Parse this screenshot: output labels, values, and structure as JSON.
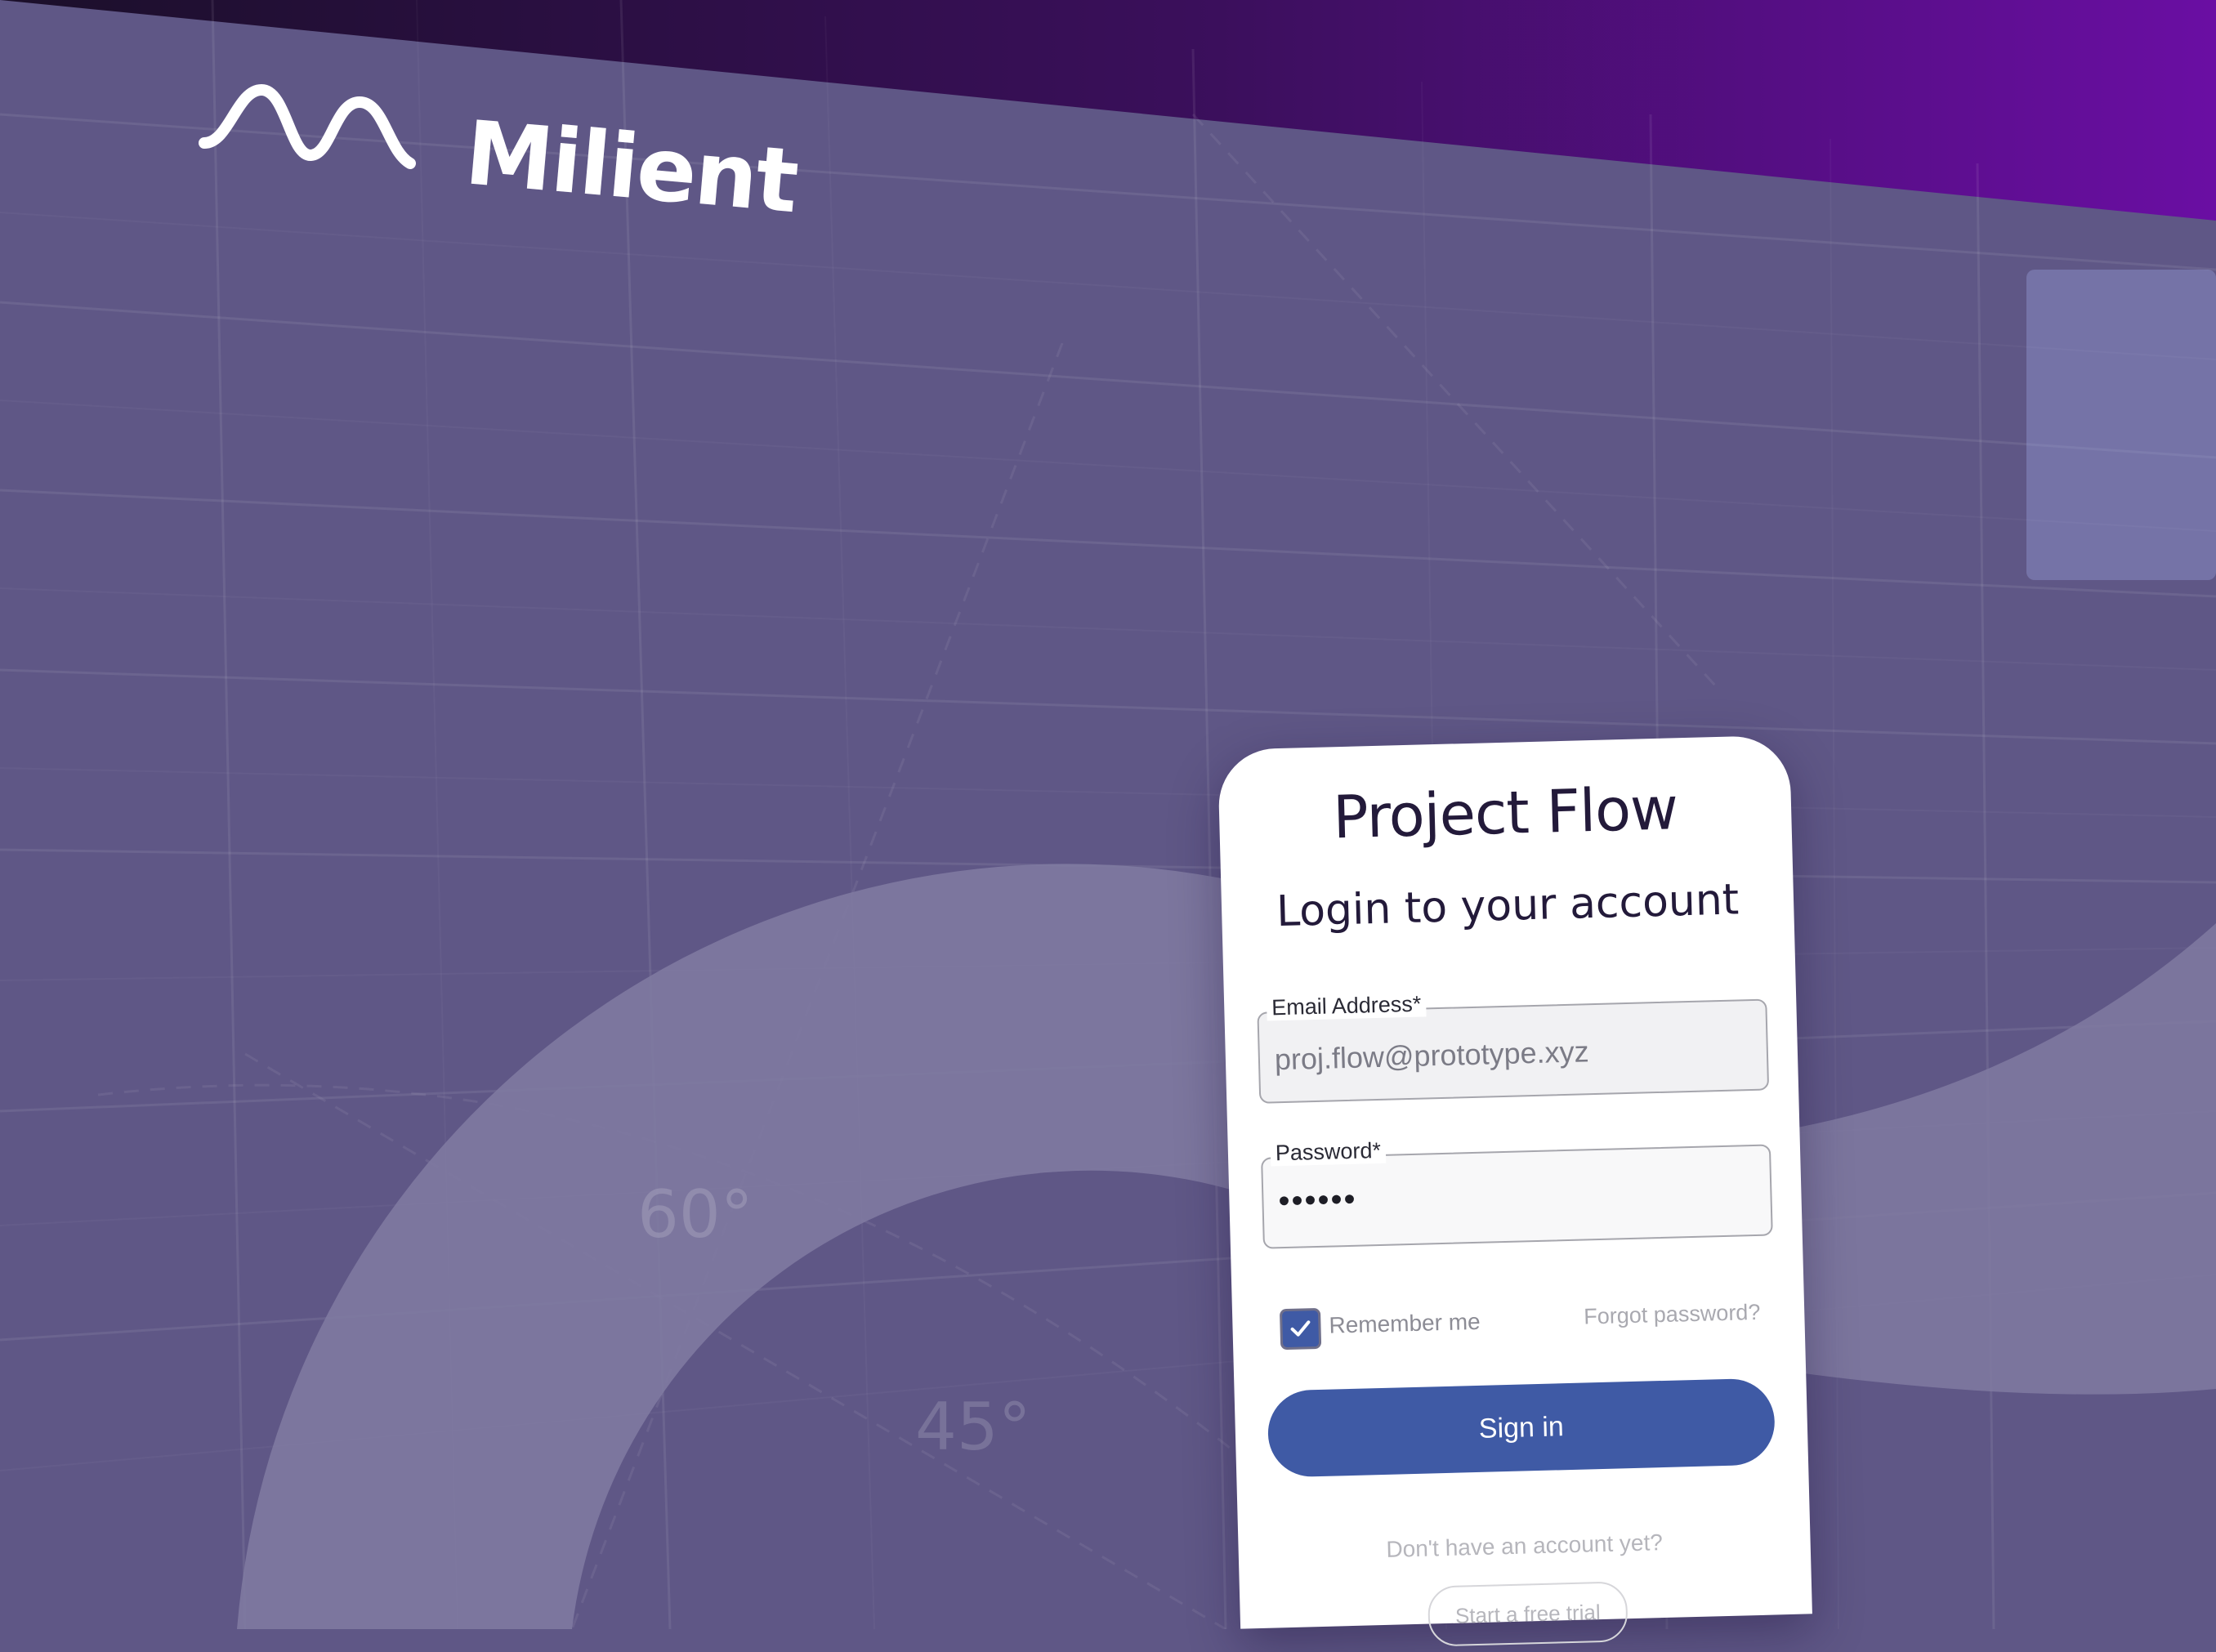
{
  "brand": {
    "name": "Milient"
  },
  "background": {
    "angle_labels": [
      "60°",
      "45°"
    ],
    "colors": {
      "canvas": "#5f5786",
      "ring": "#807aa1",
      "top_band_start": "#1b0f2a",
      "top_band_end": "#6a0ea3"
    }
  },
  "login": {
    "title": "Project Flow",
    "subtitle": "Login to your account",
    "email": {
      "label": "Email Address*",
      "value": "proj.flow@prototype.xyz"
    },
    "password": {
      "label": "Password*",
      "value": "••••••"
    },
    "remember_me": {
      "label": "Remember me",
      "checked": true
    },
    "forgot_password": "Forgot password?",
    "sign_in": "Sign in",
    "no_account": "Don't have an account yet?",
    "trial": "Start a free trial",
    "accent_color": "#3f5aa5"
  }
}
